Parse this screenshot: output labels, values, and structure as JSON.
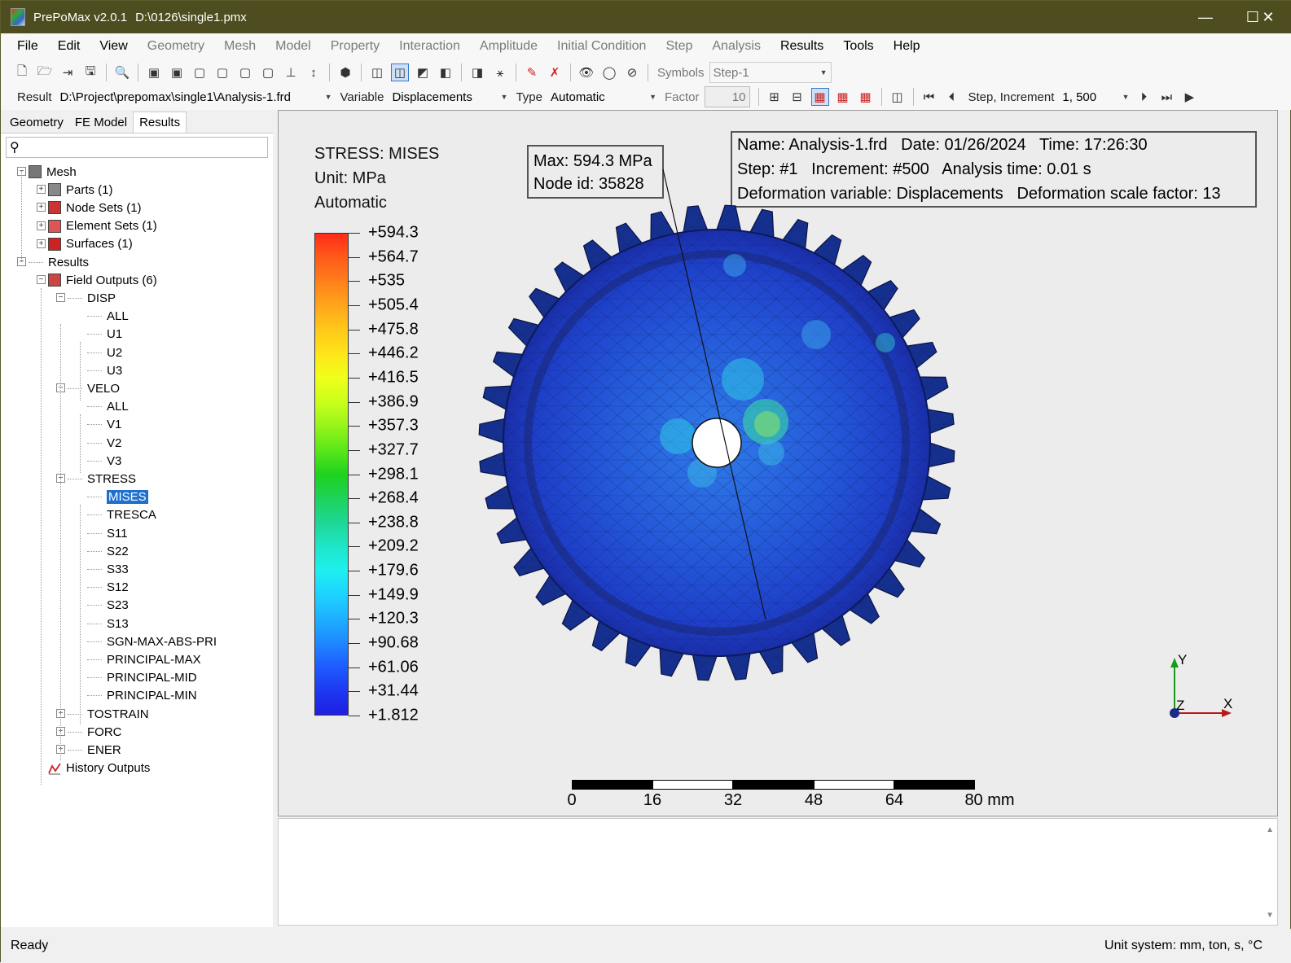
{
  "window": {
    "app_name": "PrePoMax v2.0.1",
    "file_path": "D:\\0126\\single1.pmx",
    "minimize": "—",
    "maximize": "☐",
    "close": "✕"
  },
  "menu": [
    "File",
    "Edit",
    "View",
    "Geometry",
    "Mesh",
    "Model",
    "Property",
    "Interaction",
    "Amplitude",
    "Initial Condition",
    "Step",
    "Analysis",
    "Results",
    "Tools",
    "Help"
  ],
  "menu_dim": [
    false,
    false,
    false,
    true,
    true,
    true,
    true,
    true,
    true,
    true,
    true,
    true,
    false,
    false,
    false
  ],
  "toolbar1": {
    "symbols_label": "Symbols",
    "step_combo": "Step-1"
  },
  "toolbar2": {
    "result_label": "Result",
    "result_path": "D:\\Project\\prepomax\\single1\\Analysis-1.frd",
    "variable_label": "Variable",
    "variable_value": "Displacements",
    "type_label": "Type",
    "type_value": "Automatic",
    "factor_label": "Factor",
    "factor_value": "10",
    "step_inc_label": "Step, Increment",
    "step_inc_value": "1, 500"
  },
  "tabs": [
    "Geometry",
    "FE Model",
    "Results"
  ],
  "active_tab": "Results",
  "tree": [
    {
      "label": "Mesh",
      "level": 0,
      "expander": "−",
      "icon": "mesh-icon"
    },
    {
      "label": "Parts (1)",
      "level": 1,
      "expander": "+",
      "icon": "parts-icon"
    },
    {
      "label": "Node Sets (1)",
      "level": 1,
      "expander": "+",
      "icon": "node-sets-icon"
    },
    {
      "label": "Element Sets (1)",
      "level": 1,
      "expander": "+",
      "icon": "element-sets-icon"
    },
    {
      "label": "Surfaces (1)",
      "level": 1,
      "expander": "+",
      "icon": "surfaces-icon"
    },
    {
      "label": "Results",
      "level": 0,
      "expander": "−",
      "icon": ""
    },
    {
      "label": "Field Outputs (6)",
      "level": 1,
      "expander": "−",
      "icon": "field-outputs-icon"
    },
    {
      "label": "DISP",
      "level": 2,
      "expander": "−",
      "icon": ""
    },
    {
      "label": "ALL",
      "level": 3,
      "expander": "",
      "icon": ""
    },
    {
      "label": "U1",
      "level": 3,
      "expander": "",
      "icon": ""
    },
    {
      "label": "U2",
      "level": 3,
      "expander": "",
      "icon": ""
    },
    {
      "label": "U3",
      "level": 3,
      "expander": "",
      "icon": ""
    },
    {
      "label": "VELO",
      "level": 2,
      "expander": "−",
      "icon": ""
    },
    {
      "label": "ALL",
      "level": 3,
      "expander": "",
      "icon": ""
    },
    {
      "label": "V1",
      "level": 3,
      "expander": "",
      "icon": ""
    },
    {
      "label": "V2",
      "level": 3,
      "expander": "",
      "icon": ""
    },
    {
      "label": "V3",
      "level": 3,
      "expander": "",
      "icon": ""
    },
    {
      "label": "STRESS",
      "level": 2,
      "expander": "−",
      "icon": ""
    },
    {
      "label": "MISES",
      "level": 3,
      "expander": "",
      "icon": "",
      "selected": true
    },
    {
      "label": "TRESCA",
      "level": 3,
      "expander": "",
      "icon": ""
    },
    {
      "label": "S11",
      "level": 3,
      "expander": "",
      "icon": ""
    },
    {
      "label": "S22",
      "level": 3,
      "expander": "",
      "icon": ""
    },
    {
      "label": "S33",
      "level": 3,
      "expander": "",
      "icon": ""
    },
    {
      "label": "S12",
      "level": 3,
      "expander": "",
      "icon": ""
    },
    {
      "label": "S23",
      "level": 3,
      "expander": "",
      "icon": ""
    },
    {
      "label": "S13",
      "level": 3,
      "expander": "",
      "icon": ""
    },
    {
      "label": "SGN-MAX-ABS-PRI",
      "level": 3,
      "expander": "",
      "icon": ""
    },
    {
      "label": "PRINCIPAL-MAX",
      "level": 3,
      "expander": "",
      "icon": ""
    },
    {
      "label": "PRINCIPAL-MID",
      "level": 3,
      "expander": "",
      "icon": ""
    },
    {
      "label": "PRINCIPAL-MIN",
      "level": 3,
      "expander": "",
      "icon": ""
    },
    {
      "label": "TOSTRAIN",
      "level": 2,
      "expander": "+",
      "icon": ""
    },
    {
      "label": "FORC",
      "level": 2,
      "expander": "+",
      "icon": ""
    },
    {
      "label": "ENER",
      "level": 2,
      "expander": "+",
      "icon": ""
    },
    {
      "label": "History Outputs",
      "level": 1,
      "expander": "",
      "icon": "history-outputs-icon"
    }
  ],
  "legend": {
    "title": "STRESS: MISES",
    "unit": "Unit: MPa",
    "mode": "Automatic",
    "values": [
      "+594.3",
      "+564.7",
      "+535",
      "+505.4",
      "+475.8",
      "+446.2",
      "+416.5",
      "+386.9",
      "+357.3",
      "+327.7",
      "+298.1",
      "+268.4",
      "+238.8",
      "+209.2",
      "+179.6",
      "+149.9",
      "+120.3",
      "+90.68",
      "+61.06",
      "+31.44",
      "+1.812"
    ],
    "colors": [
      "#ff2a1a",
      "#ff5a1a",
      "#ff7f1a",
      "#ffa51a",
      "#ffc81a",
      "#ffe51a",
      "#f0ff1a",
      "#c8ff1a",
      "#96f51a",
      "#5ae61a",
      "#1ed21e",
      "#1ed25a",
      "#1ed796",
      "#1ee6c8",
      "#1ef0f0",
      "#1ed2ff",
      "#1eafff",
      "#1e87ff",
      "#1e5aff",
      "#1e37f0",
      "#1e1ee1"
    ]
  },
  "max_box": {
    "max": "Max: 594.3 MPa",
    "node": "Node id: 35828"
  },
  "info_box": {
    "line1": "Name: Analysis-1.frd   Date: 01/26/2024   Time: 17:26:30",
    "line2": "Step: #1   Increment: #500   Analysis time: 0.01 s",
    "line3": "Deformation variable: Displacements   Deformation scale factor: 13"
  },
  "scale_bar": {
    "labels": [
      "0",
      "16",
      "32",
      "48",
      "64",
      "80 mm"
    ]
  },
  "axes": {
    "y": "Y",
    "z": "Z",
    "x": "X"
  },
  "status": {
    "left": "Ready",
    "right": "Unit system: mm, ton, s, °C"
  }
}
